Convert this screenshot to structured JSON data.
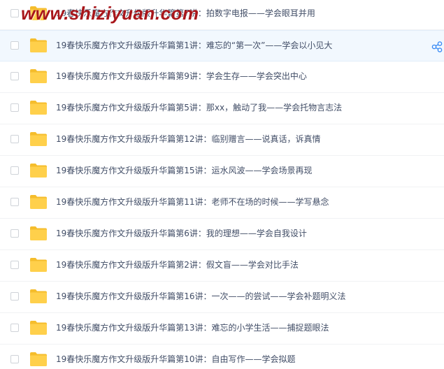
{
  "watermark": "www.shiziyuan.com",
  "files": [
    {
      "name": "19春快乐魔方作文升级版升华篇第7讲：拍数字电报——学会眼耳并用"
    },
    {
      "name": "19春快乐魔方作文升级版升华篇第1讲：难忘的“第一次”——学会以小见大",
      "highlighted": true
    },
    {
      "name": "19春快乐魔方作文升级版升华篇第9讲：学会生存——学会突出中心"
    },
    {
      "name": "19春快乐魔方作文升级版升华篇第5讲：那xx，触动了我——学会托物言志法"
    },
    {
      "name": "19春快乐魔方作文升级版升华篇第12讲：临别赠言——说真话，诉真情"
    },
    {
      "name": "19春快乐魔方作文升级版升华篇第15讲：运水风波——学会场景再现"
    },
    {
      "name": "19春快乐魔方作文升级版升华篇第11讲：老师不在场的时候——学写悬念"
    },
    {
      "name": "19春快乐魔方作文升级版升华篇第6讲：我的理想——学会自我设计"
    },
    {
      "name": "19春快乐魔方作文升级版升华篇第2讲：假文盲——学会对比手法"
    },
    {
      "name": "19春快乐魔方作文升级版升华篇第16讲：一次——的尝试——学会补题明义法"
    },
    {
      "name": "19春快乐魔方作文升级版升华篇第13讲：难忘的小学生活——捕捉题眼法"
    },
    {
      "name": "19春快乐魔方作文升级版升华篇第10讲：自由写作——学会拟题"
    }
  ],
  "icons": {
    "folder": "folder-icon",
    "share": "share-icon"
  },
  "colors": {
    "folder": "#ffd04b",
    "folder_tab": "#f5bd2c",
    "text": "#424e67",
    "highlight_bg": "#f2f8fe",
    "share": "#3b8cf5",
    "watermark": "#a8161b"
  }
}
